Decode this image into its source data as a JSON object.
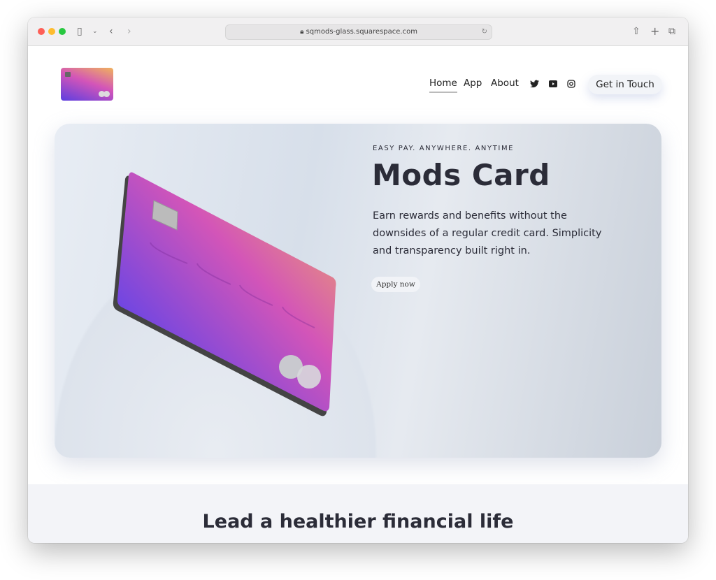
{
  "browser": {
    "url": "sqmods-glass.squarespace.com"
  },
  "nav": {
    "items": [
      {
        "label": "Home",
        "active": true
      },
      {
        "label": "App"
      },
      {
        "label": "About"
      }
    ],
    "social": [
      "twitter-icon",
      "youtube-icon",
      "instagram-icon"
    ],
    "cta": "Get in Touch"
  },
  "hero": {
    "eyebrow": "EASY PAY. ANYWHERE. ANYTIME",
    "title": "Mods Card",
    "description": "Earn rewards and benefits without the downsides of a regular credit card. Simplicity and transparency built right in.",
    "button": "Apply now"
  },
  "section2": {
    "heading": "Lead a healthier financial life"
  },
  "colors": {
    "text": "#2b2c38",
    "card_gradient": [
      "#f0b25c",
      "#d355b8",
      "#5c3ee0"
    ]
  }
}
